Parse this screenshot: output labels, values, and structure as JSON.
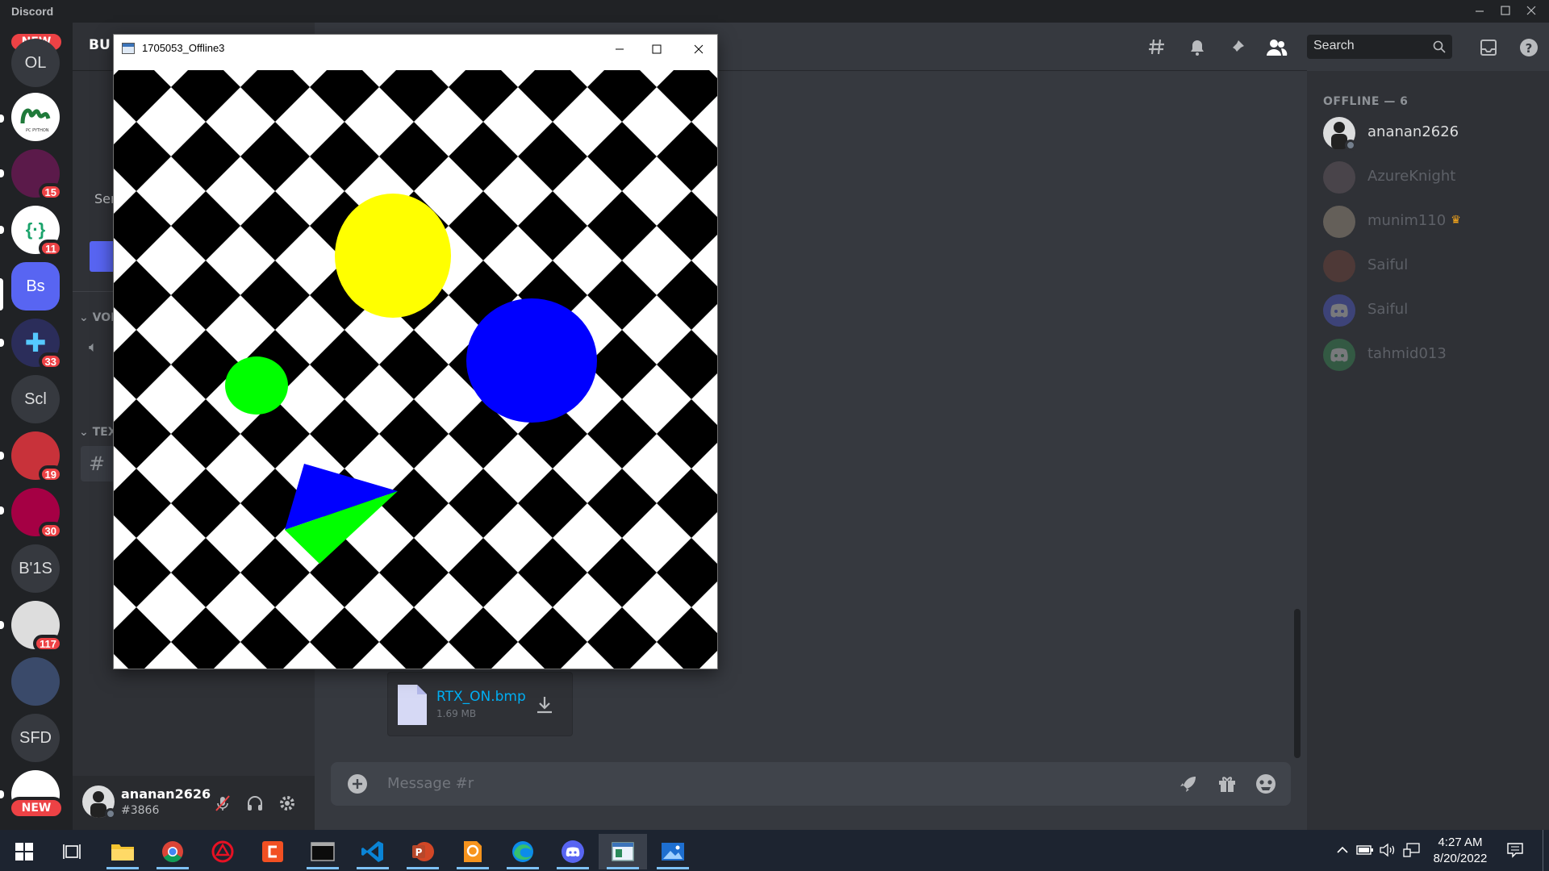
{
  "discord": {
    "app_name": "Discord",
    "channel_header_partial": "BU",
    "categories": {
      "voice_partial": "VOI",
      "text_partial": "TEX"
    },
    "sidebar_text_partial": "Ser",
    "user": {
      "name": "ananan2626",
      "tag": "#3866"
    },
    "search": {
      "placeholder": "Search"
    },
    "composer": {
      "placeholder": "Message #r"
    },
    "attachment": {
      "filename": "RTX_ON.bmp",
      "size": "1.69 MB"
    },
    "members": {
      "section": "OFFLINE — 6",
      "list": [
        {
          "name": "ananan2626",
          "online_style": true,
          "avatar_color": "#dcddde"
        },
        {
          "name": "AzureKnight",
          "online_style": false,
          "avatar_color": "#7a6b70"
        },
        {
          "name": "munim110",
          "online_style": false,
          "avatar_color": "#c8b89a",
          "crown": true
        },
        {
          "name": "Saiful",
          "online_style": false,
          "avatar_color": "#8a4a3a"
        },
        {
          "name": "Saiful",
          "online_style": false,
          "avatar_color": "#5865f2",
          "discord_logo": true
        },
        {
          "name": "tahmid013",
          "online_style": false,
          "avatar_color": "#3ba55d",
          "discord_logo": true
        }
      ]
    },
    "servers": [
      {
        "label": "OL",
        "badge": ""
      },
      {
        "label": "",
        "badge": "",
        "icon": "python-icon"
      },
      {
        "label": "",
        "badge": "15"
      },
      {
        "label": "",
        "badge": "11",
        "icon": "code-braces-icon"
      },
      {
        "label": "Bs",
        "badge": "",
        "active": true
      },
      {
        "label": "",
        "badge": "33"
      },
      {
        "label": "Scl",
        "badge": ""
      },
      {
        "label": "",
        "badge": "19"
      },
      {
        "label": "",
        "badge": "30"
      },
      {
        "label": "B'1S",
        "badge": ""
      },
      {
        "label": "",
        "badge": "117"
      },
      {
        "label": "",
        "badge": ""
      },
      {
        "label": "SFD",
        "badge": ""
      },
      {
        "label": "",
        "badge": ""
      }
    ],
    "new_badge": "NEW",
    "colors": {
      "accent": "#5865f2",
      "mention": "#ed4245",
      "link": "#00aff4"
    }
  },
  "app_window": {
    "title": "1705053_Offline3",
    "scene": {
      "description_colors": {
        "yellow": "#ffff00",
        "blue": "#0000ff",
        "green": "#00ff00",
        "tile_dark": "#000000",
        "tile_light": "#ffffff"
      }
    }
  },
  "taskbar": {
    "time": "4:27 AM",
    "date": "8/20/2022",
    "apps": [
      "windows-start",
      "task-view",
      "file-explorer",
      "chrome",
      "antivirus",
      "ppt-red",
      "terminal",
      "vscode",
      "powerpoint",
      "pdf-reader",
      "edge",
      "discord",
      "opengl-window",
      "photos"
    ]
  }
}
